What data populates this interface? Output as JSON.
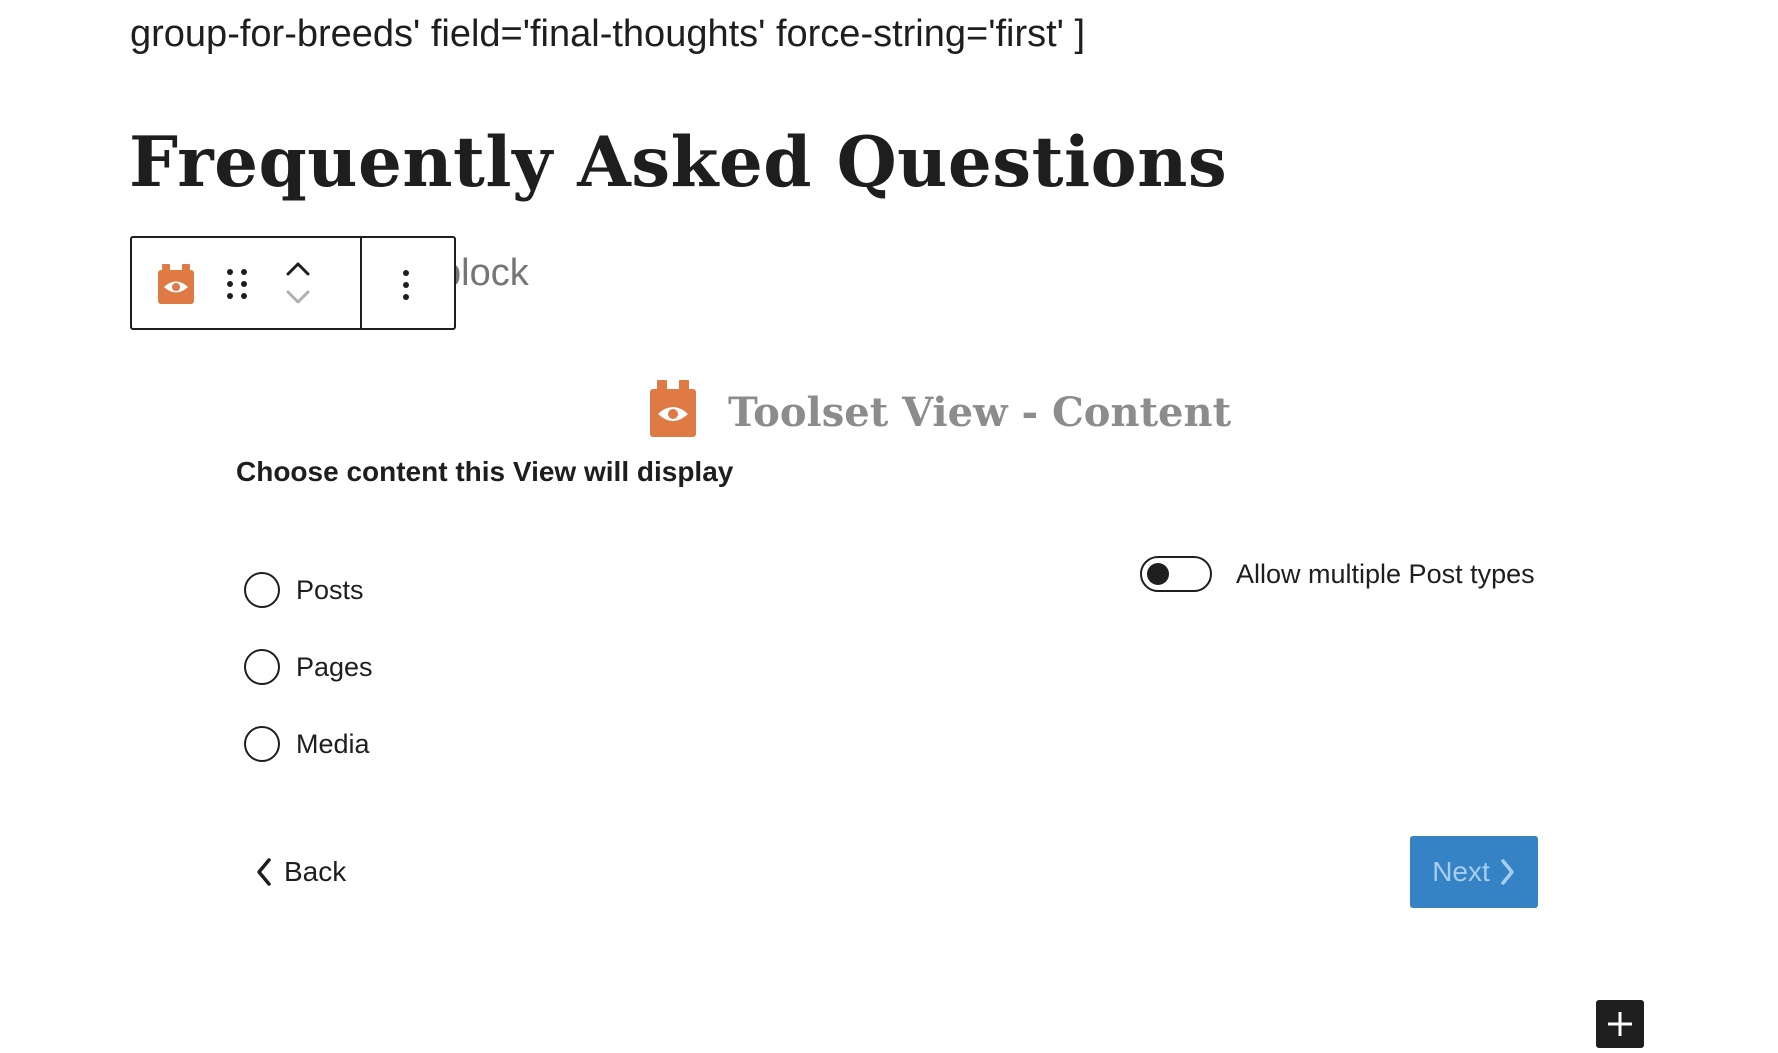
{
  "editor": {
    "shortcode_text": "group-for-breeds' field='final-thoughts' force-string='first' ]",
    "heading": "Frequently Asked Questions",
    "placeholder_text": "block"
  },
  "block_toolbar": {
    "icons": [
      "toolset-view-icon",
      "drag-handle-icon",
      "chevron-up-icon",
      "chevron-down-icon",
      "more-options-icon"
    ]
  },
  "wizard": {
    "title": "Toolset View - Content",
    "subtitle": "Choose content this View will display",
    "options": [
      {
        "label": "Posts",
        "selected": false
      },
      {
        "label": "Pages",
        "selected": false
      },
      {
        "label": "Media",
        "selected": false
      }
    ],
    "toggle": {
      "label": "Allow multiple Post types",
      "checked": false
    },
    "back_label": "Back",
    "next_label": "Next"
  },
  "colors": {
    "brand_orange": "#e07a45",
    "next_button_bg": "#3582c4",
    "next_button_text": "#a7cdef",
    "title_gray": "#8c8c8c"
  }
}
